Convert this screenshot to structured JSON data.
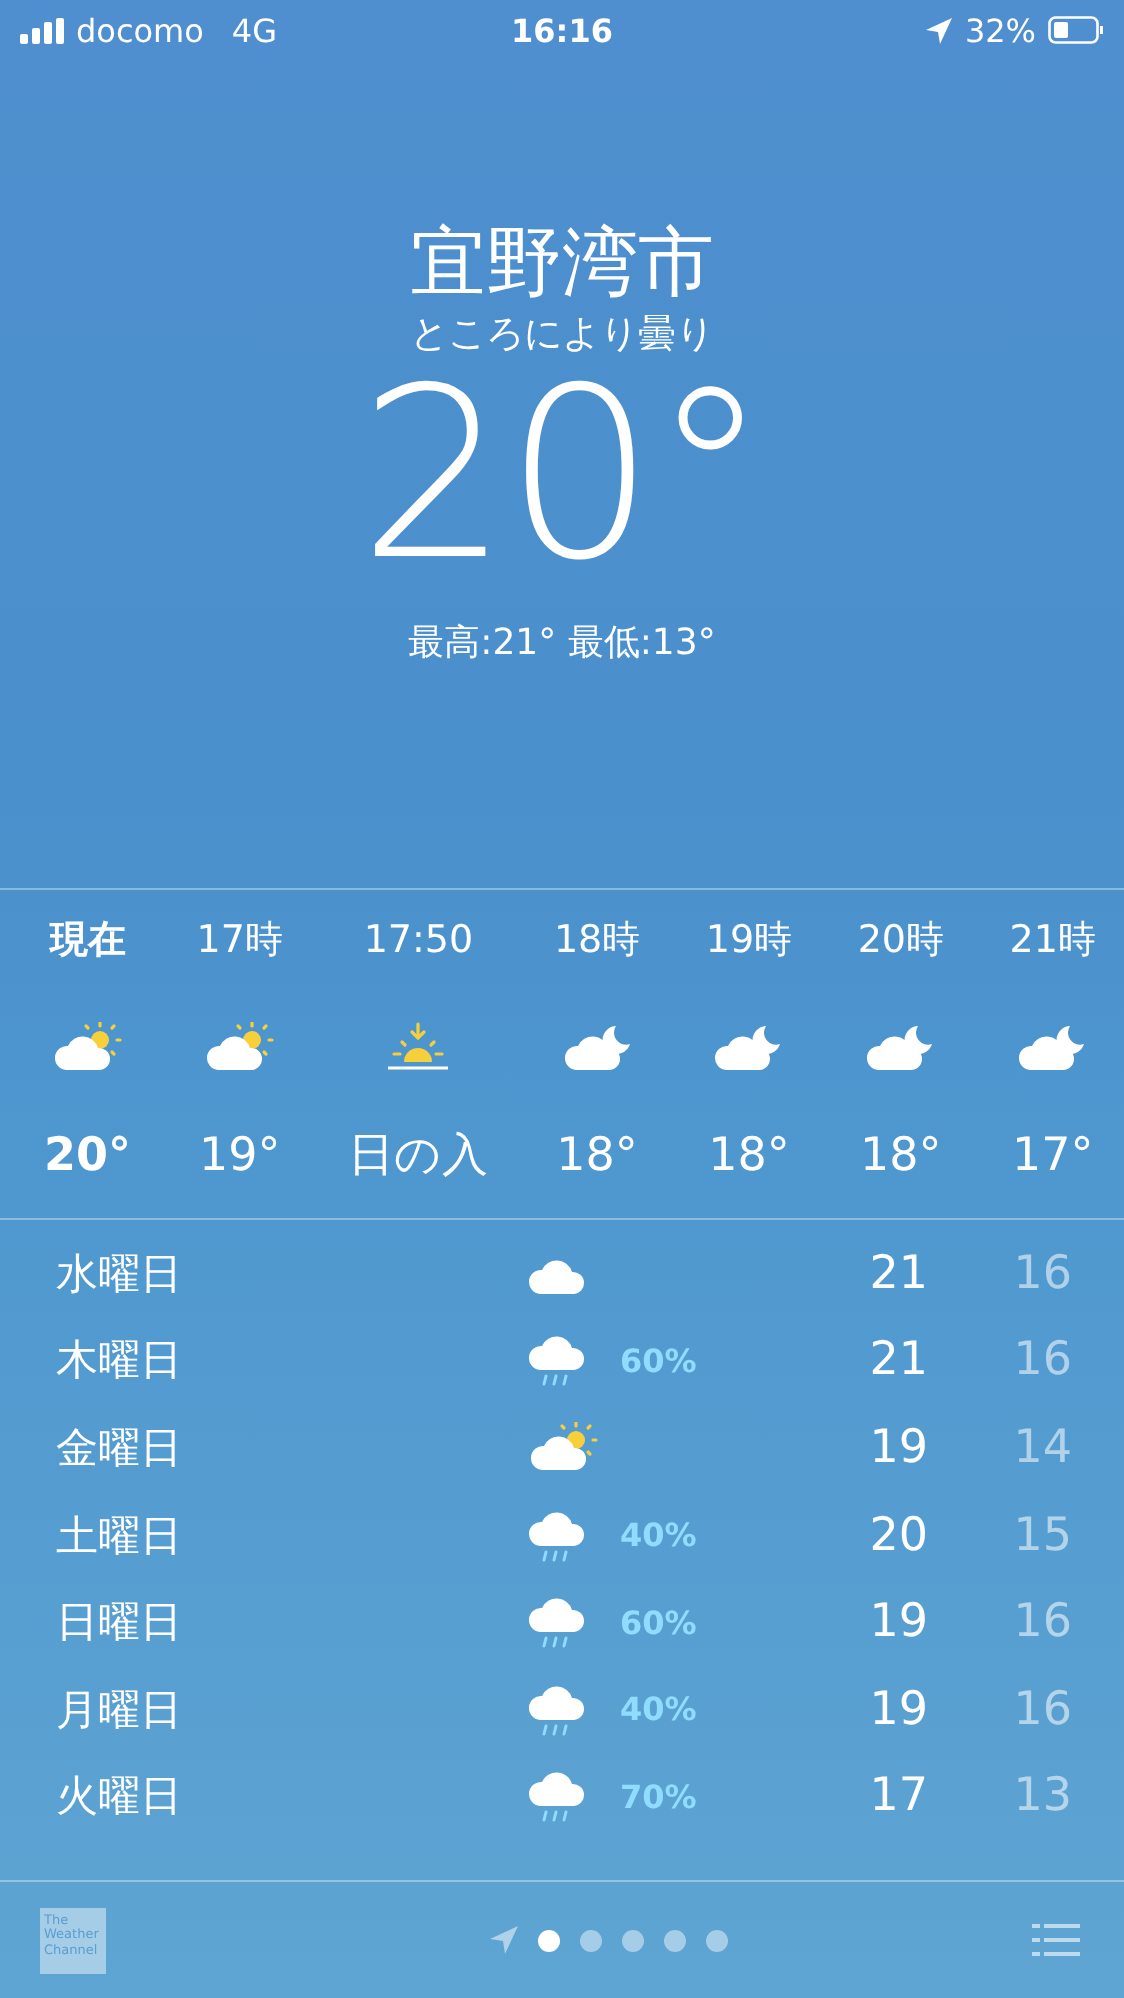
{
  "status_bar": {
    "carrier": "docomo",
    "network": "4G",
    "time": "16:16",
    "battery": "32%"
  },
  "location": {
    "city": "宜野湾市",
    "condition": "ところにより曇り",
    "temperature": "20°",
    "high_low": "最高:21° 最低:13°"
  },
  "hourly": [
    {
      "time": "現在",
      "kind": "cloud-sun",
      "value": "20°",
      "now": true
    },
    {
      "time": "17時",
      "kind": "cloud-sun",
      "value": "19°",
      "now": false
    },
    {
      "time": "17:50",
      "kind": "sunset",
      "value": "日の入",
      "now": false
    },
    {
      "time": "18時",
      "kind": "cloud-moon",
      "value": "18°",
      "now": false
    },
    {
      "time": "19時",
      "kind": "cloud-moon",
      "value": "18°",
      "now": false
    },
    {
      "time": "20時",
      "kind": "cloud-moon",
      "value": "18°",
      "now": false
    },
    {
      "time": "21時",
      "kind": "cloud-moon",
      "value": "17°",
      "now": false
    }
  ],
  "daily": [
    {
      "day": "水曜日",
      "kind": "cloud",
      "high": "21",
      "low": "16"
    },
    {
      "day": "木曜日",
      "kind": "rain",
      "chance": "60%",
      "high": "21",
      "low": "16"
    },
    {
      "day": "金曜日",
      "kind": "cloud-sun",
      "high": "19",
      "low": "14"
    },
    {
      "day": "土曜日",
      "kind": "rain",
      "chance": "40%",
      "high": "20",
      "low": "15"
    },
    {
      "day": "日曜日",
      "kind": "rain",
      "chance": "60%",
      "high": "19",
      "low": "16"
    },
    {
      "day": "月曜日",
      "kind": "rain",
      "chance": "40%",
      "high": "19",
      "low": "16"
    },
    {
      "day": "火曜日",
      "kind": "rain",
      "chance": "70%",
      "high": "17",
      "low": "13"
    }
  ],
  "footer": {
    "logo": "The Weather Channel",
    "pages": [
      {
        "selected": true
      },
      {
        "selected": false
      },
      {
        "selected": false
      },
      {
        "selected": false
      },
      {
        "selected": false
      }
    ]
  }
}
